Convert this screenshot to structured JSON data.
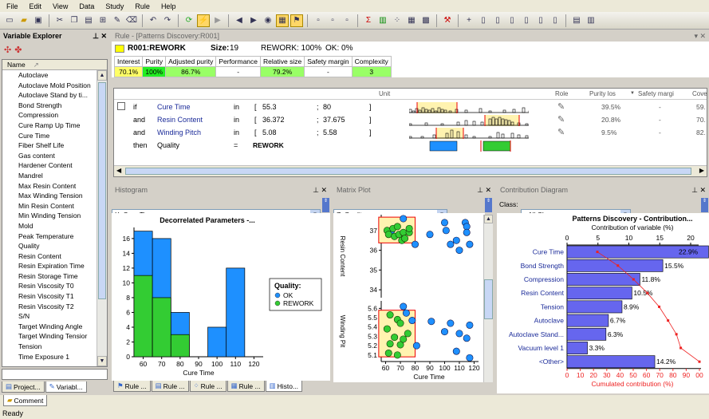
{
  "menu": [
    "File",
    "Edit",
    "View",
    "Data",
    "Study",
    "Rule",
    "Help"
  ],
  "variable_explorer": {
    "title": "Variable Explorer",
    "column_header": "Name",
    "items": [
      "Autoclave",
      "Autoclave Mold Position",
      "Autoclave Stand by ti...",
      "Bond Strength",
      "Compression",
      "Cure Ramp Up Time",
      "Cure Time",
      "Fiber Shelf Life",
      "Gas content",
      "Hardener Content",
      "Mandrel",
      "Max Resin Content",
      "Max Winding Tension",
      "Min Resin Content",
      "Min Winding Tension",
      "Mold",
      "Peak Temperature",
      "Quality",
      "Resin Content",
      "Resin Expiration Time",
      "Resin Storage Time",
      "Resin Viscosity T0",
      "Resin Viscosity T1",
      "Resin Viscosity T2",
      "S/N",
      "Target Winding Angle",
      "Target Winding Tensior",
      "Tension",
      "Time Exposure 1"
    ],
    "bottom_tabs": [
      "Project...",
      "Variabl..."
    ]
  },
  "rule": {
    "title": "Rule - [Patterns Discovery:R001]",
    "id": "R001:REWORK",
    "size_label": "Size:",
    "size": "19",
    "rework": "REWORK: 100%",
    "ok": "OK: 0%",
    "metrics_headers": [
      "Interest",
      "Purity",
      "Adjusted purity",
      "Performance",
      "Relative size",
      "Safety margin",
      "Complexity"
    ],
    "metrics_values": [
      "70.1%",
      "100%",
      "86.7%",
      "-",
      "79.2%",
      "-",
      "3"
    ],
    "metrics_colors": [
      "#ffff66",
      "#22ee22",
      "#99ff66",
      "#ffffff",
      "#99ff66",
      "#ffffff",
      "#99ff66"
    ],
    "grid_headers": [
      "Unit",
      "Role",
      "Purity los",
      "Safety margi",
      "Cove"
    ],
    "conditions": [
      {
        "kw": "if",
        "var": "Cure Time",
        "op": "in",
        "lb": "[",
        "lo": "55.3",
        "sep": ";",
        "hi": "80",
        "rb": "]",
        "role": "✎",
        "purity": "39.5%",
        "safety": "-",
        "cov": "59."
      },
      {
        "kw": "and",
        "var": "Resin Content",
        "op": "in",
        "lb": "[",
        "lo": "36.372",
        "sep": ";",
        "hi": "37.675",
        "rb": "]",
        "role": "✎",
        "purity": "20.8%",
        "safety": "-",
        "cov": "70."
      },
      {
        "kw": "and",
        "var": "Winding Pitch",
        "op": "in",
        "lb": "[",
        "lo": "5.08",
        "sep": ";",
        "hi": "5.58",
        "rb": "]",
        "role": "✎",
        "purity": "9.5%",
        "safety": "-",
        "cov": "82."
      }
    ],
    "then": {
      "kw": "then",
      "var": "Quality",
      "op": "=",
      "val": "REWORK"
    }
  },
  "histogram": {
    "title": "Histogram",
    "axis_select": "X: Cure Time",
    "bottom_tabs": [
      "Rule ...",
      "Rule ...",
      "Rule ...",
      "Rule ...",
      "Histo..."
    ]
  },
  "matrix": {
    "title": "Matrix Plot",
    "axis_select": "Z: Quality"
  },
  "contribution": {
    "title": "Contribution Diagram",
    "class_label": "Class:",
    "class_select": "<All Classes>"
  },
  "status": "Ready",
  "comment_tab": "Comment",
  "chart_data": [
    {
      "type": "bar",
      "title": "Decorrelated Parameters -...",
      "xlabel": "Cure Time",
      "categories": [
        "60",
        "70",
        "80",
        "90",
        "100",
        "110",
        "120"
      ],
      "bin_edges": [
        55,
        65,
        75,
        85,
        95,
        105,
        115,
        125
      ],
      "series": [
        {
          "name": "OK",
          "color": "#1e90ff",
          "values": [
            17,
            16,
            6,
            0,
            4,
            12,
            0
          ]
        },
        {
          "name": "REWORK",
          "color": "#33cc33",
          "values": [
            11,
            8,
            3,
            0,
            0,
            0,
            0
          ]
        }
      ],
      "ylim": [
        0,
        17.5
      ],
      "yticks": [
        0,
        2,
        4,
        6,
        8,
        10,
        12,
        14,
        16
      ],
      "legend_title": "Quality:",
      "legend_placement": "right"
    },
    {
      "type": "scatter",
      "xlabel": "Cure Time",
      "xticks": [
        60,
        70,
        80,
        90,
        100,
        110,
        120
      ],
      "top": {
        "ylabel": "Resin Content",
        "yticks": [
          34,
          35,
          36,
          37
        ],
        "ylim": [
          33.6,
          37.8
        ]
      },
      "bottom": {
        "ylabel": "Winding Pit",
        "yticks": [
          5.1,
          5.2,
          5.3,
          5.4,
          5.5,
          5.6
        ],
        "ylim": [
          5.03,
          5.68
        ]
      },
      "xlim": [
        57,
        123
      ],
      "top_ok": [
        [
          72,
          37.6
        ],
        [
          100,
          37.4
        ],
        [
          114,
          37.4
        ],
        [
          115,
          37.2
        ],
        [
          101,
          37.0
        ],
        [
          115,
          36.9
        ],
        [
          90,
          36.8
        ],
        [
          108,
          36.5
        ],
        [
          104,
          36.3
        ],
        [
          117,
          36.3
        ],
        [
          80,
          36.3
        ],
        [
          110,
          36.0
        ],
        [
          64,
          37.0
        ]
      ],
      "top_rework": [
        [
          61,
          37.0
        ],
        [
          62,
          36.8
        ],
        [
          66,
          36.7
        ],
        [
          69,
          36.8
        ],
        [
          72,
          36.9
        ],
        [
          76,
          36.9
        ],
        [
          65,
          37.1
        ],
        [
          71,
          36.5
        ],
        [
          68,
          37.2
        ],
        [
          73,
          36.6
        ],
        [
          76,
          37.1
        ]
      ],
      "bottom_ok": [
        [
          72,
          5.62
        ],
        [
          74,
          5.55
        ],
        [
          91,
          5.46
        ],
        [
          104,
          5.44
        ],
        [
          117,
          5.42
        ],
        [
          100,
          5.35
        ],
        [
          110,
          5.33
        ],
        [
          115,
          5.28
        ],
        [
          108,
          5.14
        ],
        [
          117,
          5.07
        ],
        [
          78,
          5.47
        ],
        [
          81,
          5.2
        ]
      ],
      "bottom_rework": [
        [
          63,
          5.53
        ],
        [
          68,
          5.48
        ],
        [
          61,
          5.38
        ],
        [
          70,
          5.44
        ],
        [
          75,
          5.33
        ],
        [
          63,
          5.22
        ],
        [
          70,
          5.21
        ],
        [
          62,
          5.12
        ],
        [
          68,
          5.1
        ],
        [
          72,
          5.27
        ],
        [
          66,
          5.29
        ]
      ],
      "top_box": [
        55.3,
        80,
        36.372,
        37.675
      ],
      "bottom_box": [
        55.3,
        80,
        5.08,
        5.58
      ]
    },
    {
      "type": "bar",
      "title": "Patterns Discovery - Contribution...",
      "xlabel": "Cumulated contribution (%)",
      "x2label": "Contribution of variable (%)",
      "categories": [
        "Cure Time",
        "Bond Strength",
        "Compression",
        "Resin Content",
        "Tension",
        "Autoclave",
        "Autoclave Stand...",
        "Vacuum level 1",
        "<Other>"
      ],
      "values": [
        22.9,
        15.5,
        11.8,
        10.5,
        8.9,
        6.7,
        6.3,
        3.3,
        14.2
      ],
      "labels": [
        "22.9%",
        "15.5%",
        "11.8%",
        "10.5%",
        "8.9%",
        "6.7%",
        "6.3%",
        "3.3%",
        "14.2%"
      ],
      "cumulative": [
        22.9,
        38.4,
        50.2,
        60.7,
        69.6,
        76.3,
        82.6,
        85.9,
        100
      ],
      "xticks_top": [
        0,
        5,
        10,
        15,
        20
      ],
      "xticks_bottom": [
        0,
        10,
        20,
        30,
        40,
        50,
        60,
        70,
        80,
        90,
        100
      ],
      "bottom_tick_labels": [
        "0",
        "10",
        "20",
        "30",
        "40",
        "50",
        "60",
        "70",
        "80",
        "90",
        "00"
      ],
      "bar_color": "#6666ee",
      "line_color": "#ee2222"
    }
  ]
}
